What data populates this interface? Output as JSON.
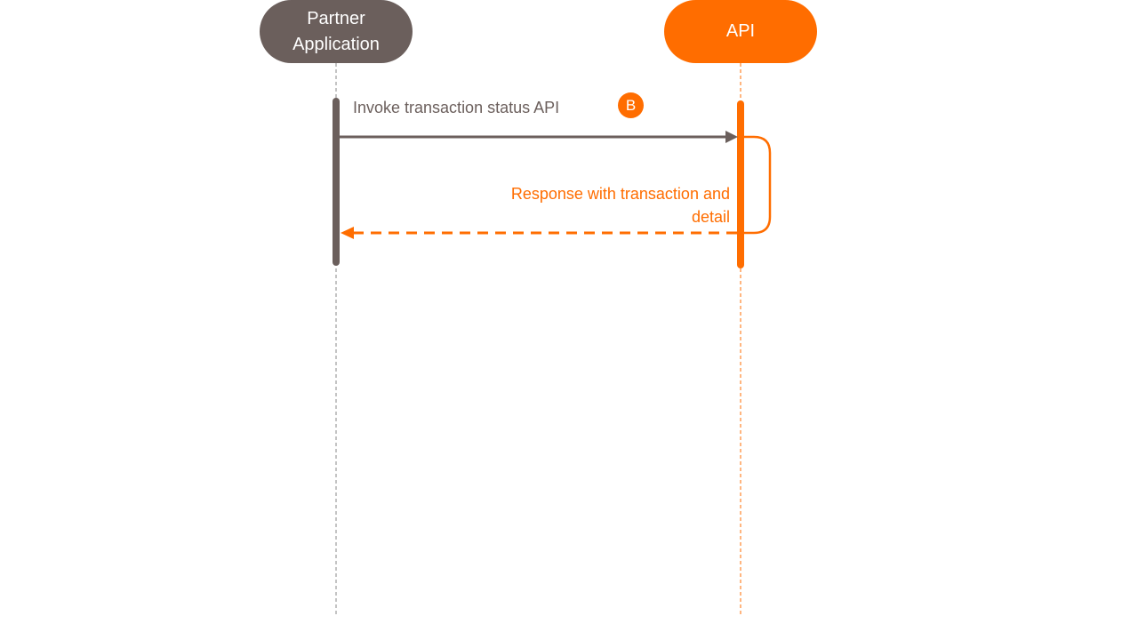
{
  "diagram": {
    "type": "sequence",
    "colors": {
      "partner": "#6b5f5c",
      "api": "#ff6d00",
      "background": "#ffffff"
    },
    "participants": [
      {
        "id": "partner",
        "label": "Partner\nApplication"
      },
      {
        "id": "api",
        "label": "API"
      }
    ],
    "messages": [
      {
        "from": "partner",
        "to": "api",
        "label": "Invoke transaction status API",
        "style": "solid",
        "badge": "B"
      },
      {
        "from": "api",
        "to": "partner",
        "label": "Response with transaction and\ndetail",
        "style": "dashed"
      }
    ]
  }
}
